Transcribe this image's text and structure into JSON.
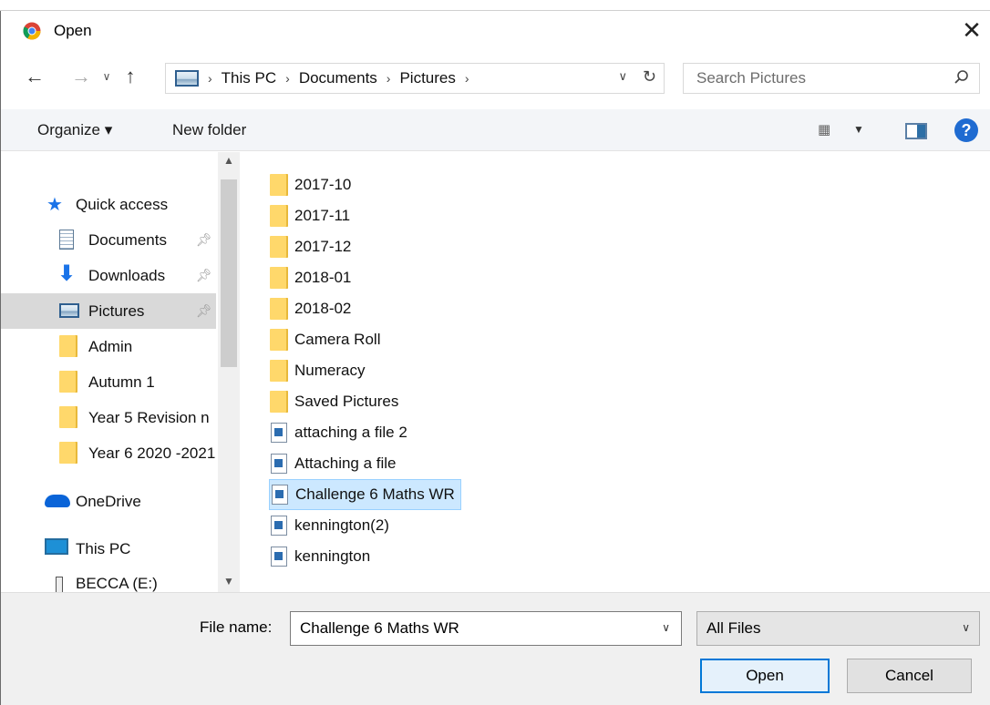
{
  "window": {
    "title": "Open"
  },
  "nav": {
    "breadcrumbs": [
      "This PC",
      "Documents",
      "Pictures"
    ],
    "search_placeholder": "Search Pictures"
  },
  "toolbar": {
    "organize_label": "Organize ▾",
    "new_folder_label": "New folder",
    "help_label": "?"
  },
  "navpane": {
    "items": [
      {
        "label": "Quick access"
      },
      {
        "label": "Documents"
      },
      {
        "label": "Downloads"
      },
      {
        "label": "Pictures"
      },
      {
        "label": "Admin"
      },
      {
        "label": "Autumn 1"
      },
      {
        "label": "Year 5 Revision n"
      },
      {
        "label": "Year 6 2020 -2021"
      },
      {
        "label": "OneDrive"
      },
      {
        "label": "This PC"
      },
      {
        "label": "BECCA (E:)"
      }
    ]
  },
  "files": [
    {
      "name": "2017-10",
      "type": "folder"
    },
    {
      "name": "2017-11",
      "type": "folder"
    },
    {
      "name": "2017-12",
      "type": "folder"
    },
    {
      "name": "2018-01",
      "type": "folder"
    },
    {
      "name": "2018-02",
      "type": "folder"
    },
    {
      "name": "Camera Roll",
      "type": "folder"
    },
    {
      "name": "Numeracy",
      "type": "folder"
    },
    {
      "name": "Saved Pictures",
      "type": "folder"
    },
    {
      "name": "attaching a file 2",
      "type": "image"
    },
    {
      "name": "Attaching a file",
      "type": "image"
    },
    {
      "name": "Challenge 6 Maths WR",
      "type": "image",
      "selected": true
    },
    {
      "name": "kennington(2)",
      "type": "image"
    },
    {
      "name": "kennington",
      "type": "image"
    }
  ],
  "bottom": {
    "file_name_label": "File name:",
    "file_name_value": "Challenge 6 Maths WR",
    "file_type_value": "All Files",
    "open_label": "Open",
    "cancel_label": "Cancel"
  },
  "colors": {
    "selection": "#cce8ff",
    "folder": "#ffd86b",
    "accent": "#0078d7"
  }
}
